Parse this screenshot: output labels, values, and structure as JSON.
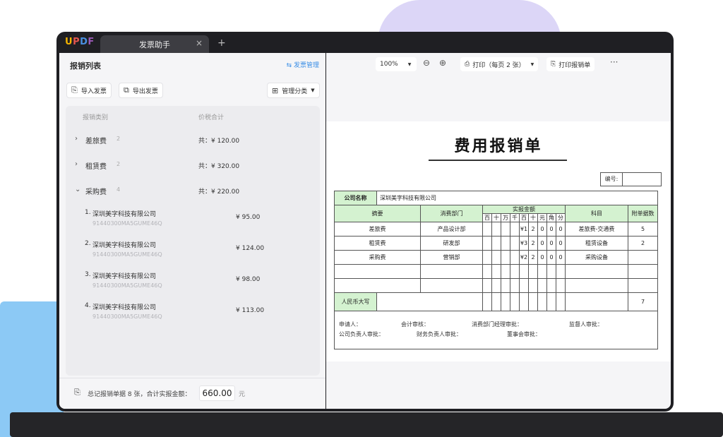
{
  "app": {
    "logo": "UPDF",
    "tab_title": "发票助手",
    "tab_close": "×",
    "new_tab": "+"
  },
  "left": {
    "title": "报销列表",
    "manage_link": "发票管理",
    "manage_icon": "swap-icon",
    "import_label": "导入发票",
    "export_label": "导出发票",
    "category_label": "管理分类",
    "col_category": "报销类别",
    "col_total": "价税合计",
    "categories": [
      {
        "name": "差旅费",
        "count": "2",
        "total": "共：¥ 120.00",
        "expanded": false
      },
      {
        "name": "租赁费",
        "count": "2",
        "total": "共：¥ 320.00",
        "expanded": false
      },
      {
        "name": "采购费",
        "count": "4",
        "total": "共：¥ 220.00",
        "expanded": true
      }
    ],
    "items": [
      {
        "idx": "1.",
        "name": "深圳美字科技有限公司",
        "code": "91440300MA5GUME46Q",
        "amount": "¥ 95.00"
      },
      {
        "idx": "2.",
        "name": "深圳美字科技有限公司",
        "code": "91440300MA5GUME46Q",
        "amount": "¥ 124.00"
      },
      {
        "idx": "3.",
        "name": "深圳美字科技有限公司",
        "code": "91440300MA5GUME46Q",
        "amount": "¥ 98.00"
      },
      {
        "idx": "4.",
        "name": "深圳美字科技有限公司",
        "code": "91440300MA5GUME46Q",
        "amount": "¥ 113.00"
      }
    ],
    "footer_text": "总记报销单据 8 张，合计实报金额：",
    "footer_value": "660.00",
    "footer_unit": "元"
  },
  "toolbar": {
    "zoom": "100%",
    "print_label": "打印（每页 2 张）",
    "print_report_label": "打印报销单",
    "more": "···"
  },
  "report": {
    "title": "费用报销单",
    "no_label": "编号:",
    "company_label": "公司名称",
    "company_value": "深圳美字科技有限公司",
    "h_summary": "摘要",
    "h_dept": "消费部门",
    "h_amount": "实报金额",
    "h_subject": "科目",
    "h_attach": "附单据数",
    "digits": [
      "百",
      "十",
      "万",
      "千",
      "百",
      "十",
      "元",
      "角",
      "分"
    ],
    "rows": [
      {
        "summary": "差旅费",
        "dept": "产品设计部",
        "digits": [
          "",
          "",
          "",
          "",
          "¥1",
          "2",
          "0",
          "0",
          "0"
        ],
        "subject": "差旅费-交通费",
        "attach": "5"
      },
      {
        "summary": "租赁费",
        "dept": "研发部",
        "digits": [
          "",
          "",
          "",
          "",
          "¥3",
          "2",
          "0",
          "0",
          "0"
        ],
        "subject": "租赁设备",
        "attach": "2"
      },
      {
        "summary": "采购费",
        "dept": "营销部",
        "digits": [
          "",
          "",
          "",
          "",
          "¥2",
          "2",
          "0",
          "0",
          "0"
        ],
        "subject": "采购设备",
        "attach": ""
      }
    ],
    "rmb_label": "人民币大写",
    "total_attach": "7",
    "sig1": [
      "申请人：",
      "会计审核：",
      "消费部门经理审批：",
      "监督人审批："
    ],
    "sig2": [
      "公司负责人审批：",
      "财务负责人审批：",
      "董事会审批："
    ]
  },
  "colors": {
    "accent": "#3a8ee6",
    "green_cell": "#d4f2d0"
  }
}
